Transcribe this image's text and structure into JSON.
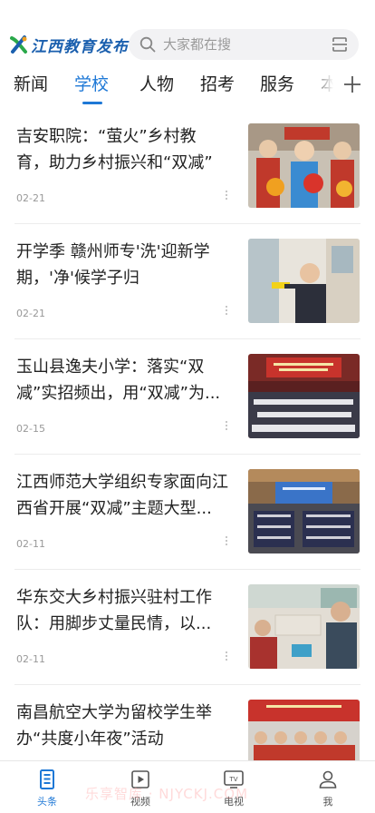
{
  "header": {
    "logo_text": "江西教育发布",
    "search": {
      "placeholder": "大家都在搜"
    }
  },
  "tabs": [
    {
      "label": "新闻",
      "active": false
    },
    {
      "label": "学校",
      "active": true
    },
    {
      "label": "人物",
      "active": false
    },
    {
      "label": "招考",
      "active": false
    },
    {
      "label": "服务",
      "active": false
    },
    {
      "label": "本",
      "active": false
    }
  ],
  "news": [
    {
      "title": "吉安职院：“萤火”乡村教育，助力乡村振兴和“双减”",
      "date": "02-21"
    },
    {
      "title": "开学季 赣州师专'洗'迎新学期，'净'候学子归",
      "date": "02-21"
    },
    {
      "title": "玉山县逸夫小学：落实“双减”实招频出，用“双减”为...",
      "date": "02-15"
    },
    {
      "title": "江西师范大学组织专家面向江西省开展“双减”主题大型...",
      "date": "02-11"
    },
    {
      "title": "华东交大乡村振兴驻村工作队：用脚步丈量民情，以...",
      "date": "02-11"
    },
    {
      "title": "南昌航空大学为留校学生举办“共度小年夜”活动",
      "date": ""
    }
  ],
  "bottom_nav": [
    {
      "label": "头条",
      "icon": "headline-icon",
      "active": true
    },
    {
      "label": "视频",
      "icon": "video-icon",
      "active": false
    },
    {
      "label": "电视",
      "icon": "tv-icon",
      "active": false
    },
    {
      "label": "我",
      "icon": "user-icon",
      "active": false
    }
  ],
  "tv_icon_text": "TV",
  "watermark": "乐享智库 · NJYCKJ.COM",
  "colors": {
    "accent": "#1e78d6",
    "logo": "#1a5fae"
  }
}
